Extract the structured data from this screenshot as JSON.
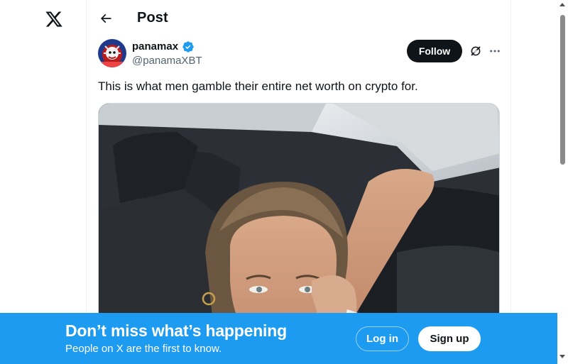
{
  "header": {
    "title": "Post",
    "back_icon": "arrow-left-icon"
  },
  "nav": {
    "logo_icon": "x-logo-icon"
  },
  "post": {
    "author_name": "panamax",
    "author_handle": "@panamaXBT",
    "verified": true,
    "follow_label": "Follow",
    "text": "This is what men gamble their entire net worth on crypto for.",
    "actions": [
      "grok-icon",
      "more-icon"
    ]
  },
  "banner": {
    "title": "Don’t miss what’s happening",
    "subtitle": "People on X are the first to know.",
    "login_label": "Log in",
    "signup_label": "Sign up"
  },
  "colors": {
    "accent": "#1d9bf0",
    "text_primary": "#0f1419",
    "text_secondary": "#536471",
    "follow_bg": "#0f1419"
  }
}
